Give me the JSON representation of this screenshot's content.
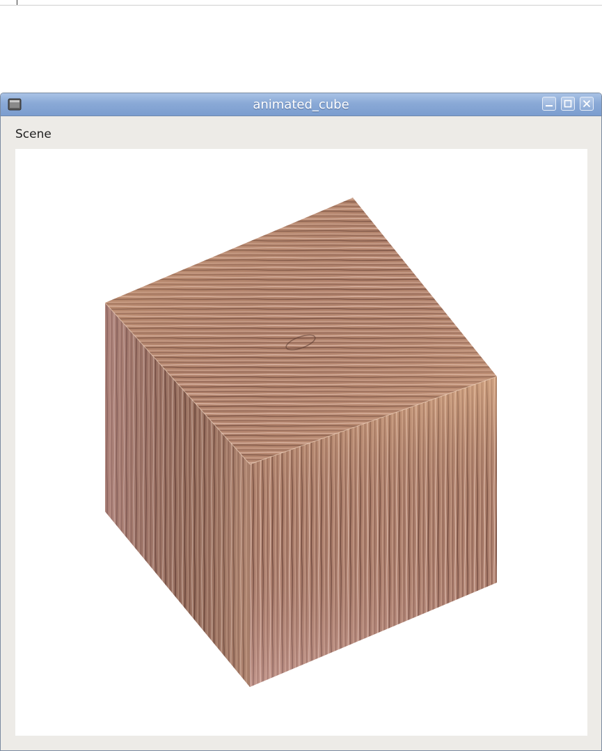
{
  "window": {
    "title": "animated_cube",
    "icon": "app-window-icon",
    "buttons": {
      "minimize": "minimize-icon",
      "maximize": "maximize-icon",
      "close": "close-icon"
    }
  },
  "menubar": {
    "items": [
      {
        "label": "Scene"
      }
    ]
  },
  "scene": {
    "object": "textured-cube",
    "texture": "wood",
    "colors": {
      "wood_light": "#d7ac84",
      "wood_mid": "#a87a66",
      "wood_dark": "#6e4a3d",
      "wood_pink": "#c89a92"
    }
  },
  "colors": {
    "titlebar": "#8aa9d6",
    "window_bg": "#edebe7",
    "canvas_bg": "#ffffff"
  }
}
